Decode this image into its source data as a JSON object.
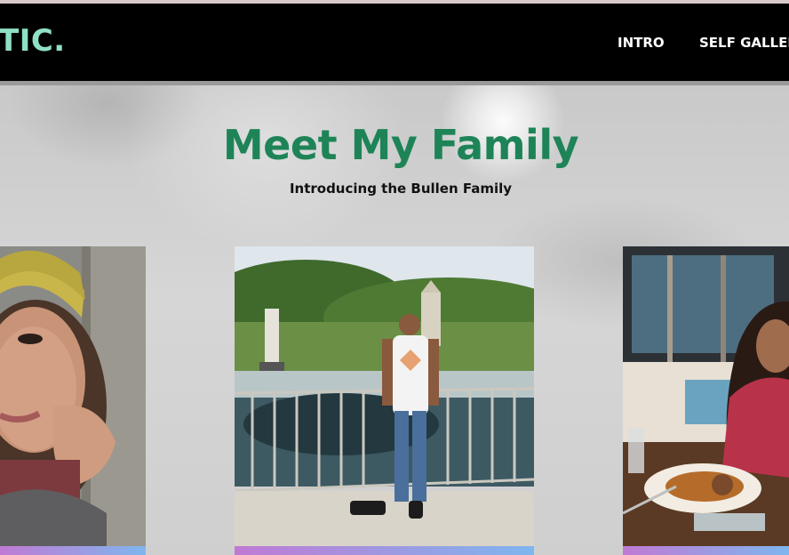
{
  "header": {
    "logo_text": "TIC.",
    "nav": [
      {
        "label": "INTRO"
      },
      {
        "label": "SELF GALLERY"
      }
    ]
  },
  "hero": {
    "title": "Meet My Family",
    "subtitle": "Introducing the Bullen Family"
  },
  "colors": {
    "navbar": "#000000",
    "logo": "#8fe0c4",
    "title": "#1e8458",
    "card_bar_start": "#7fb6ee",
    "card_bar_end": "#c07ad4"
  },
  "cards": [
    {
      "name": "portrait-woman-hardhat"
    },
    {
      "name": "portrait-man-fountain"
    },
    {
      "name": "portrait-woman-restaurant"
    }
  ]
}
